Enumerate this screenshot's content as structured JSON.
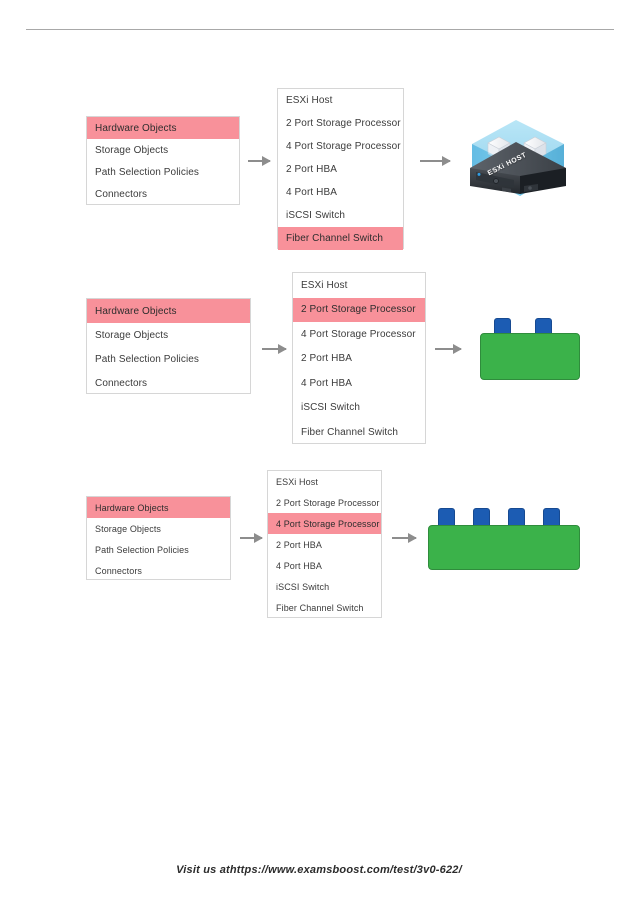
{
  "page": {
    "footer_text": "Visit us athttps://www.examsboost.com/test/3v0-622/"
  },
  "colors": {
    "highlight_pink": "#F8919A",
    "box_border": "#D6D6D6",
    "arrow_gray": "#8D8D8D",
    "block_green": "#3BB24A",
    "tab_blue": "#1C5CB3",
    "rule_gray": "#A8A8A8",
    "text": "#3B3B3B"
  },
  "categories_list": {
    "items": [
      {
        "label": "Hardware Objects",
        "highlighted": true
      },
      {
        "label": "Storage Objects",
        "highlighted": false
      },
      {
        "label": "Path Selection Policies",
        "highlighted": false
      },
      {
        "label": "Connectors",
        "highlighted": false
      }
    ]
  },
  "rows": [
    {
      "id": "row-1",
      "left_box": {
        "items": [
          {
            "label": "Hardware Objects",
            "highlighted": true
          },
          {
            "label": "Storage Objects",
            "highlighted": false
          },
          {
            "label": "Path Selection Policies",
            "highlighted": false
          },
          {
            "label": "Connectors",
            "highlighted": false
          }
        ]
      },
      "middle_box": {
        "items": [
          {
            "label": "ESXi Host",
            "highlighted": false
          },
          {
            "label": "2 Port Storage Processor",
            "highlighted": false
          },
          {
            "label": "4 Port Storage Processor",
            "highlighted": false
          },
          {
            "label": "2 Port HBA",
            "highlighted": false
          },
          {
            "label": "4 Port HBA",
            "highlighted": false
          },
          {
            "label": "iSCSI Switch",
            "highlighted": false
          },
          {
            "label": "Fiber Channel Switch",
            "highlighted": true
          }
        ]
      },
      "result": {
        "type": "esxi-host-icon",
        "label": "ESXi HOST",
        "ports": 0
      }
    },
    {
      "id": "row-2",
      "left_box": {
        "items": [
          {
            "label": "Hardware Objects",
            "highlighted": true
          },
          {
            "label": "Storage Objects",
            "highlighted": false
          },
          {
            "label": "Path Selection Policies",
            "highlighted": false
          },
          {
            "label": "Connectors",
            "highlighted": false
          }
        ]
      },
      "middle_box": {
        "items": [
          {
            "label": "ESXi Host",
            "highlighted": false
          },
          {
            "label": "2 Port Storage Processor",
            "highlighted": true
          },
          {
            "label": "4 Port Storage Processor",
            "highlighted": false
          },
          {
            "label": "2 Port HBA",
            "highlighted": false
          },
          {
            "label": "4 Port HBA",
            "highlighted": false
          },
          {
            "label": "iSCSI Switch",
            "highlighted": false
          },
          {
            "label": "Fiber Channel Switch",
            "highlighted": false
          }
        ]
      },
      "result": {
        "type": "storage-processor-block",
        "label": "",
        "ports": 2
      }
    },
    {
      "id": "row-3",
      "left_box": {
        "items": [
          {
            "label": "Hardware Objects",
            "highlighted": true
          },
          {
            "label": "Storage Objects",
            "highlighted": false
          },
          {
            "label": "Path Selection Policies",
            "highlighted": false
          },
          {
            "label": "Connectors",
            "highlighted": false
          }
        ]
      },
      "middle_box": {
        "items": [
          {
            "label": "ESXi Host",
            "highlighted": false
          },
          {
            "label": "2 Port Storage Processor",
            "highlighted": false
          },
          {
            "label": "4 Port Storage Processor",
            "highlighted": true
          },
          {
            "label": "2 Port HBA",
            "highlighted": false
          },
          {
            "label": "4 Port HBA",
            "highlighted": false
          },
          {
            "label": "iSCSI Switch",
            "highlighted": false
          },
          {
            "label": "Fiber Channel Switch",
            "highlighted": false
          }
        ]
      },
      "result": {
        "type": "storage-processor-block",
        "label": "",
        "ports": 4
      }
    }
  ]
}
